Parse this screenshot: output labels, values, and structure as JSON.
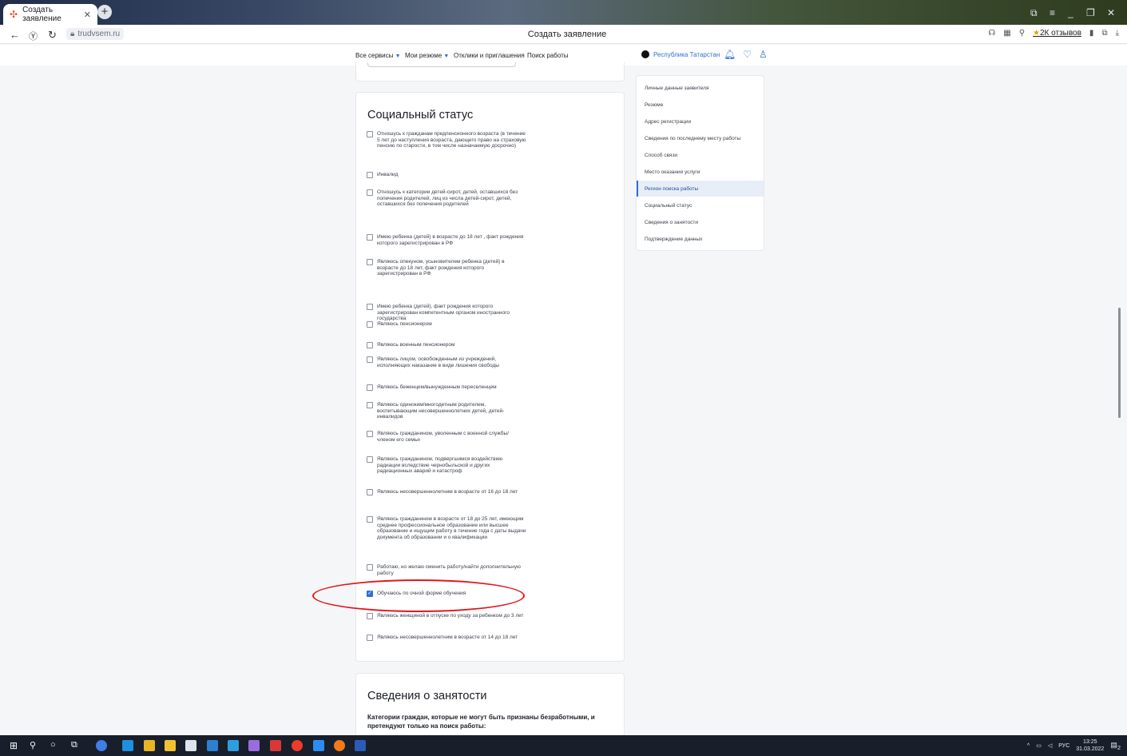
{
  "browser": {
    "tab_title": "Создать заявление",
    "url": "trudvsem.ru",
    "page_title": "Создать заявление",
    "reviews_label": "2К отзывов"
  },
  "site_nav": {
    "items": [
      "Все сервисы",
      "Мои резюме",
      "Отклики и приглашения",
      "Поиск работы"
    ],
    "region": "Республика Татарстан"
  },
  "social_status": {
    "title": "Социальный статус",
    "options": [
      {
        "label": "Отношусь к гражданам предпенсионного возраста (в течение 5 лет до наступления возраста, дающего право на страховую пенсию по старости, в том числе назначаемую досрочно)",
        "checked": false
      },
      {
        "label": "Инвалид",
        "checked": false
      },
      {
        "label": "Отношусь к категории детей-сирот, детей, оставшихся без попечения родителей, лиц из числа детей-сирот, детей, оставшихся без попечения родителей",
        "checked": false
      },
      {
        "label": "Имею ребенка (детей) в возрасте до 18 лет , факт рождения которого зарегистрирован в РФ",
        "checked": false
      },
      {
        "label": "Являюсь опекуном, усыновителем ребенка (детей) в возрасте до 18 лет, факт рождения которого зарегистрирован в РФ",
        "checked": false
      },
      {
        "label": "Имею ребенка (детей), факт рождения которого зарегистрирован компетентным органом иностранного государства",
        "checked": false
      },
      {
        "label": "Являюсь пенсионером",
        "checked": false
      },
      {
        "label": "Являюсь военным пенсионером",
        "checked": false
      },
      {
        "label": "Являюсь лицом, освобожденным из учреждений, исполняющих наказание в виде лишения свободы",
        "checked": false
      },
      {
        "label": "Являюсь беженцем/вынужденным переселенцем",
        "checked": false
      },
      {
        "label": "Являюсь одиноким/многодетным родителем, воспитывающим несовершеннолетних детей, детей-инвалидов",
        "checked": false
      },
      {
        "label": "Являюсь гражданином, уволенным с военной службы/членом его семьи",
        "checked": false
      },
      {
        "label": "Являюсь гражданином, подвергшимся воздействию радиации вследствие чернобыльской и других радиационных аварий и катастроф",
        "checked": false
      },
      {
        "label": "Являюсь несовершеннолетним в возрасте от 16 до 18 лет",
        "checked": false
      },
      {
        "label": "Являюсь гражданином в возрасте от 18 до 25 лет, имеющим среднее профессиональное образование или высшее образование и ищущим работу в течение года с даты выдачи документа об образовании и о квалификации",
        "checked": false
      },
      {
        "label": "Работаю, но желаю сменить работу/найти дополнительную работу",
        "checked": false
      },
      {
        "label": "Обучаюсь по очной форме обучения",
        "checked": true
      },
      {
        "label": "Являюсь женщиной в отпуске по уходу за ребенком до 3 лет",
        "checked": false
      },
      {
        "label": "Являюсь несовершеннолетним в возрасте от 14 до 18 лет",
        "checked": false
      }
    ]
  },
  "employment": {
    "title": "Сведения о занятости",
    "description": "Категории граждан, которые не могут быть признаны безработными, и претендуют только на поиск работы:"
  },
  "side_nav": {
    "items": [
      {
        "label": "Личные данные заявителя",
        "active": false
      },
      {
        "label": "Резюме",
        "active": false
      },
      {
        "label": "Адрес регистрации",
        "active": false
      },
      {
        "label": "Сведения по последнему месту работы",
        "active": false
      },
      {
        "label": "Способ связи",
        "active": false
      },
      {
        "label": "Место оказания услуги",
        "active": false
      },
      {
        "label": "Регион поиска работы",
        "active": true
      },
      {
        "label": "Социальный статус",
        "active": false
      },
      {
        "label": "Сведения о занятости",
        "active": false
      },
      {
        "label": "Подтверждение данных",
        "active": false
      }
    ]
  },
  "taskbar": {
    "lang": "РУС",
    "time": "13:25",
    "date": "31.03.2022",
    "notifications": "2"
  },
  "colors": {
    "accent": "#2f6fd7",
    "highlight_oval": "#e3161c"
  }
}
